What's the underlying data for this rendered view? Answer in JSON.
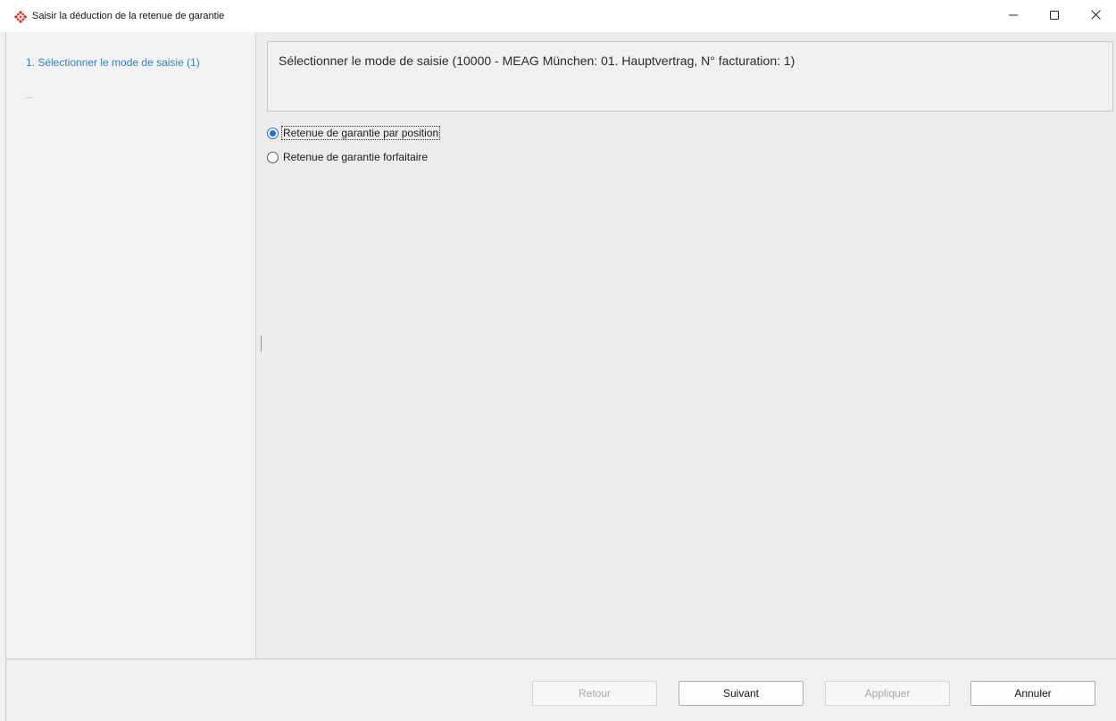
{
  "window": {
    "title": "Saisir la déduction de la retenue de garantie",
    "controls": {
      "minimize": "–",
      "maximize": "☐",
      "close": "✕"
    }
  },
  "sidebar": {
    "steps": [
      {
        "label": "1. Sélectionner le mode de saisie (1)",
        "active": true
      }
    ],
    "more": "..."
  },
  "main": {
    "header": "Sélectionner le mode de saisie (10000 - MEAG München: 01. Hauptvertrag, N° facturation: 1)",
    "options": [
      {
        "label": "Retenue de garantie par position",
        "selected": true
      },
      {
        "label": "Retenue de garantie forfaitaire",
        "selected": false
      }
    ]
  },
  "footer": {
    "back_label": "Retour",
    "next_label": "Suivant",
    "apply_label": "Appliquer",
    "cancel_label": "Annuler"
  },
  "colors": {
    "accent": "#1e6fd6",
    "step_link": "#2f7fc9",
    "app_icon": "#d9342b"
  },
  "icons": {
    "app": "app-logo-icon",
    "minimize": "minimize-icon",
    "maximize": "maximize-icon",
    "close": "close-icon"
  }
}
